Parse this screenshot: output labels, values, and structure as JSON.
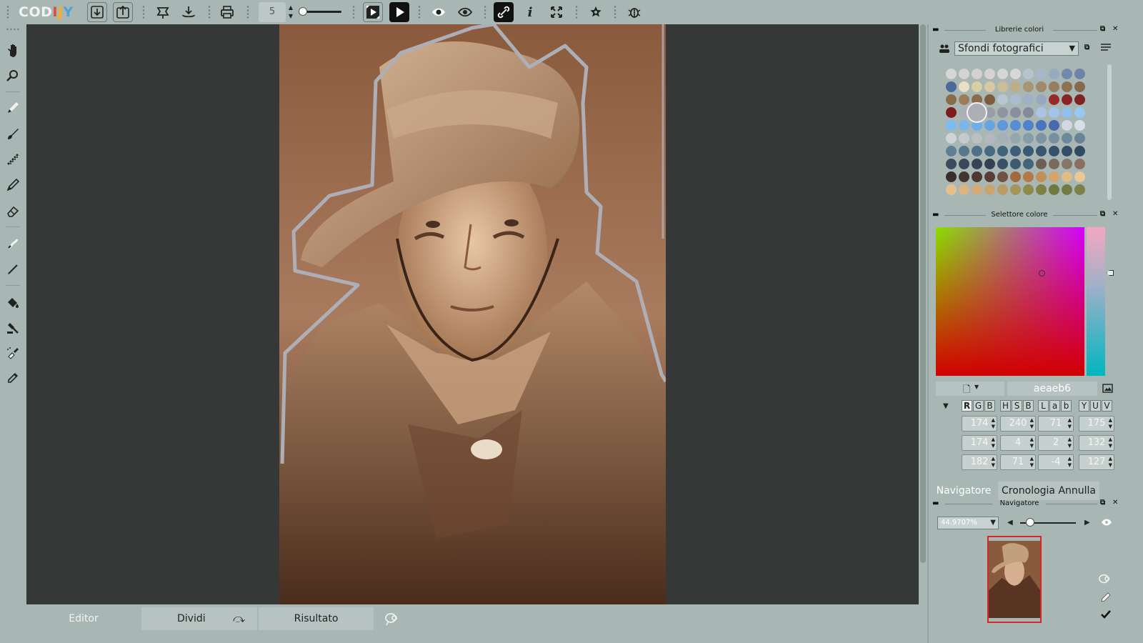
{
  "app": {
    "logo_text": "CODIJY",
    "logo_letters": [
      "C",
      "O",
      "D",
      "I",
      "J",
      "Y"
    ]
  },
  "toolbar": {
    "brush_size": "5",
    "buttons": [
      {
        "name": "import-icon"
      },
      {
        "name": "export-icon"
      },
      {
        "name": "hint-icon"
      },
      {
        "name": "save-icon"
      },
      {
        "name": "print-icon"
      },
      {
        "name": "colorize-preview-icon"
      },
      {
        "name": "play-icon"
      },
      {
        "name": "eye-icon"
      },
      {
        "name": "view-toggle-icon"
      },
      {
        "name": "link-icon"
      },
      {
        "name": "info-icon"
      },
      {
        "name": "fullscreen-icon"
      },
      {
        "name": "star-settings-icon"
      },
      {
        "name": "debug-icon"
      }
    ]
  },
  "left_tools": [
    {
      "name": "hand-tool-icon"
    },
    {
      "name": "zoom-tool-icon"
    },
    {
      "name": "pencil-tool-icon"
    },
    {
      "name": "brush-tool-icon"
    },
    {
      "name": "dotted-brush-tool-icon"
    },
    {
      "name": "outline-pencil-tool-icon"
    },
    {
      "name": "eraser-tool-icon"
    },
    {
      "name": "stroke-tool-icon"
    },
    {
      "name": "line-tool-icon"
    },
    {
      "name": "fill-bucket-tool-icon"
    },
    {
      "name": "stamp-tool-icon"
    },
    {
      "name": "spray-tool-icon"
    },
    {
      "name": "eyedropper-tool-icon"
    }
  ],
  "bottom_tabs": {
    "editor": "Editor",
    "split": "Dividi",
    "result": "Risultato"
  },
  "libraries_panel": {
    "title": "Librerie colori",
    "selected_library": "Sfondi fotografici"
  },
  "palette": [
    [
      "#d6d6d4",
      "#d4d4d2",
      "#d2d2d0",
      "#d4d4d2",
      "#d6d6d4",
      "#d8d8d6",
      "#b8c2cc",
      "#a9b8c8",
      "#96aac0",
      "#6f8aae",
      "#6c84a8"
    ],
    [
      "#4c6a98",
      "#e8e0c4",
      "#d9cfa4",
      "#d8c9a2",
      "#cbbd98",
      "#bcae88",
      "#a89673",
      "#9e8a68",
      "#957e5e",
      "#8c7253",
      "#866a4b"
    ],
    [
      "#8a6c48",
      "#9c7c58",
      "#8b6c4a",
      "#7c5c3c",
      "#b8c6d4",
      "#acbcd0",
      "#a0b0c6",
      "#98a8c0",
      "#9a2a2a",
      "#8a2424",
      "#7e2222"
    ],
    [
      "#7e1c1c",
      "#aeaeb6",
      "#a4a6b0",
      "#9a9ca6",
      "#9094a0",
      "#8a8e9c",
      "#848a98",
      "#aac4e6",
      "#a0c4ec",
      "#90c0f0",
      "#98c8f2"
    ],
    [
      "#7cbcf0",
      "#78b6ec",
      "#6eaee8",
      "#66a4e2",
      "#5e98da",
      "#568ed2",
      "#5082ca",
      "#4a74c0",
      "#466aae",
      "#d0d8e4",
      "#d8dfe8"
    ],
    [
      "#d0d4d6",
      "#c6cacc",
      "#bcc0c2",
      "#b2b8bc",
      "#a2b0b8",
      "#94a6b0",
      "#889ca8",
      "#7e94a2",
      "#7690a0",
      "#6e8a9a",
      "#6a8496"
    ],
    [
      "#607e94",
      "#56788e",
      "#4e7088",
      "#466a84",
      "#40647e",
      "#3c5e78",
      "#3a5a74",
      "#385670",
      "#34526c",
      "#324e68",
      "#304a62"
    ],
    [
      "#3c4c5e",
      "#3a4858",
      "#384454",
      "#364050",
      "#3a5066",
      "#3e5a72",
      "#44647c",
      "#6e5e56",
      "#7a6a5e",
      "#86766a",
      "#8c6e60"
    ],
    [
      "#3a2e2c",
      "#42342e",
      "#4c3a32",
      "#563e34",
      "#6e5244",
      "#a06a3c",
      "#b27a48",
      "#c48e58",
      "#d4a46c",
      "#e2bc84",
      "#ecc898"
    ],
    [
      "#e6c08c",
      "#dcb480",
      "#d4aa76",
      "#c8a46e",
      "#b89c64",
      "#a2965a",
      "#8c8a4c",
      "#7c8244",
      "#6e7a3e",
      "#727c42",
      "#7a8248"
    ]
  ],
  "color_picker": {
    "title": "Selettore colore",
    "hex": "aeaeb6",
    "groups": [
      {
        "labels": [
          "R",
          "G",
          "B"
        ],
        "values": [
          "174",
          "174",
          "182"
        ]
      },
      {
        "labels": [
          "H",
          "S",
          "B"
        ],
        "values": [
          "240",
          "4",
          "71"
        ]
      },
      {
        "labels": [
          "L",
          "a",
          "b"
        ],
        "values": [
          "71",
          "2",
          "-4"
        ]
      },
      {
        "labels": [
          "Y",
          "U",
          "V"
        ],
        "values": [
          "175",
          "132",
          "127"
        ]
      }
    ]
  },
  "navigator_tabs": {
    "navigator": "Navigatore",
    "history": "Cronologia Annulla"
  },
  "navigator": {
    "title": "Navigatore",
    "zoom": "44.9707%",
    "zoom_fraction": 0.1
  },
  "colors": {
    "panel_bg": "#a8b7b3",
    "canvas_bg": "#363838",
    "mask_outline": "#aeaeb6"
  }
}
